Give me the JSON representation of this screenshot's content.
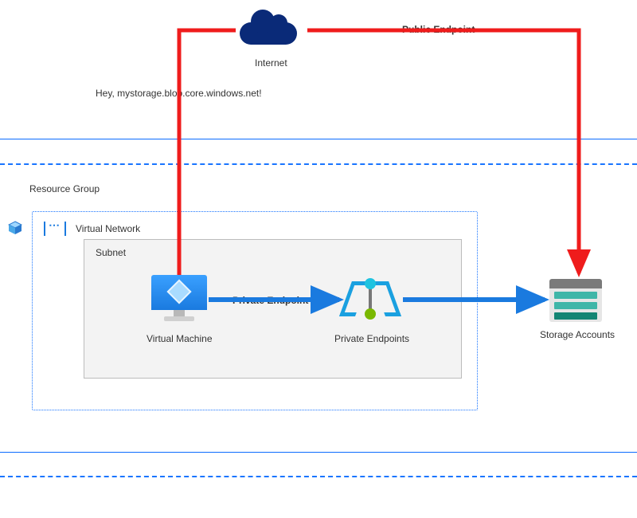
{
  "internet": {
    "label": "Internet"
  },
  "public_path": {
    "label": "Public Endpoint"
  },
  "speech": {
    "text": "Hey, mystorage.blob.core.windows.net!"
  },
  "resource_group": {
    "label": "Resource Group"
  },
  "vnet": {
    "label": "Virtual Network"
  },
  "subnet": {
    "label": "Subnet"
  },
  "vm": {
    "label": "Virtual Machine"
  },
  "private_path": {
    "label": "Private Endpoint"
  },
  "private_endpoints": {
    "label": "Private Endpoints"
  },
  "storage": {
    "label": "Storage Accounts"
  },
  "colors": {
    "public_arrow": "#ef1c1c",
    "private_arrow": "#1a7adf",
    "boundary": "#1a75ff"
  }
}
